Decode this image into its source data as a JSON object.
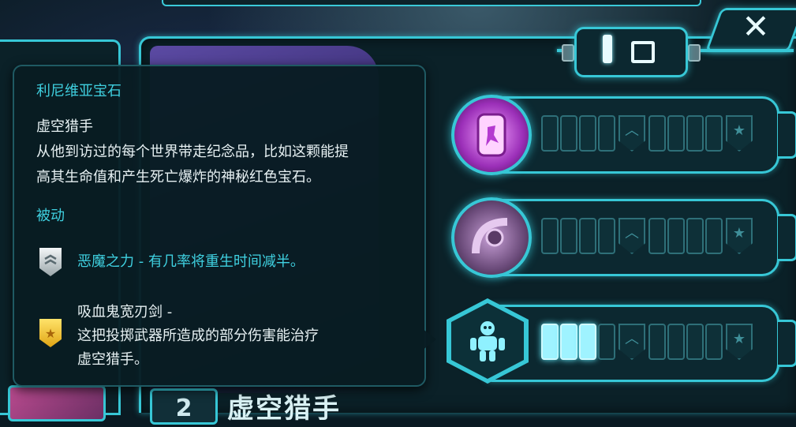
{
  "tooltip": {
    "item_name": "利尼维亚宝石",
    "hero_name": "虚空猎手",
    "description_line1": "从他到访过的每个世界带走纪念品，比如这颗能提",
    "description_line2": "高其生命值和产生死亡爆炸的神秘红色宝石。",
    "type_label": "被动",
    "skill1_text": "恶魔之力 - 有几率将重生时间减半。",
    "skill2_line1": "吸血鬼宽刃剑 -",
    "skill2_line2": "这把投掷武器所造成的部分伤害能治疗",
    "skill2_line3": "虚空猎手。"
  },
  "icons": {
    "close": "✕",
    "silver_badge": "chevron-rank-icon",
    "gold_badge": "★"
  },
  "skills": [
    {
      "icon": "portal-icon",
      "filled": 0
    },
    {
      "icon": "gem-weapon-icon",
      "filled": 0
    },
    {
      "icon": "robot-icon",
      "filled": 3
    }
  ],
  "hero_card": {
    "number": "2",
    "name": "虚空猎手"
  },
  "colors": {
    "accent": "#37c7d6",
    "highlight_text": "#3fd0e0",
    "body_text": "#e7f1f3"
  }
}
